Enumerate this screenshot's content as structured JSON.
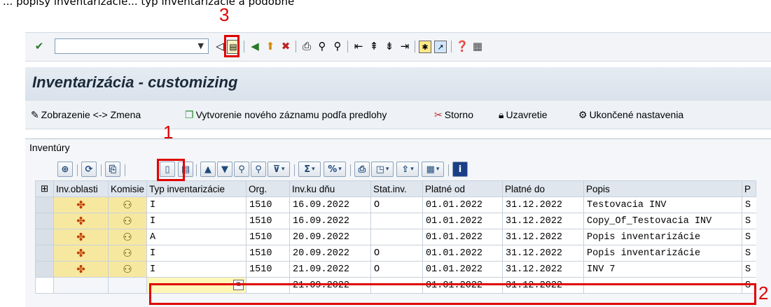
{
  "caption": "... popisy inventarizácie... typ inventarizácie a podobne",
  "annotations": {
    "step1": "1",
    "step2": "2",
    "step3": "3"
  },
  "system_toolbar": {
    "icons": [
      "enter-check-icon",
      "command-field",
      "back-arrow-icon",
      "save-icon",
      "back-green-icon",
      "exit-yellow-icon",
      "cancel-red-icon",
      "print-icon",
      "find-icon",
      "find-next-icon",
      "first-page-icon",
      "prev-page-icon",
      "next-page-icon",
      "last-page-icon",
      "new-session-icon",
      "shortcut-icon",
      "help-icon",
      "layout-menu-icon"
    ]
  },
  "title": "Inventarizácia - customizing",
  "app_toolbar": {
    "display_change": "Zobrazenie <-> Zmena",
    "create_from_template": "Vytvorenie nového záznamu podľa predlohy",
    "storno": "Storno",
    "close": "Uzavretie",
    "finished_settings": "Ukončené nastavenia"
  },
  "group_label": "Inventúry",
  "table": {
    "columns": [
      "Inv.oblasti",
      "Komisie",
      "Typ inventarizácie",
      "Org.",
      "Inv.ku dňu",
      "Stat.inv.",
      "Platné od",
      "Platné do",
      "Popis",
      "P"
    ],
    "rows": [
      {
        "typ": "I",
        "org": "1510",
        "date": "16.09.2022",
        "stat": "O",
        "od": "01.01.2022",
        "do": "31.12.2022",
        "popis": "Testovacia INV",
        "p": "S"
      },
      {
        "typ": "I",
        "org": "1510",
        "date": "16.09.2022",
        "stat": "",
        "od": "01.01.2022",
        "do": "31.12.2022",
        "popis": "Copy_Of_Testovacia INV",
        "p": "S"
      },
      {
        "typ": "A",
        "org": "1510",
        "date": "20.09.2022",
        "stat": "",
        "od": "01.01.2022",
        "do": "31.12.2022",
        "popis": "Popis inventarizácie",
        "p": "S"
      },
      {
        "typ": "I",
        "org": "1510",
        "date": "20.09.2022",
        "stat": "O",
        "od": "01.01.2022",
        "do": "31.12.2022",
        "popis": "Popis inventarizácie",
        "p": "S"
      },
      {
        "typ": "I",
        "org": "1510",
        "date": "21.09.2022",
        "stat": "O",
        "od": "01.01.2022",
        "do": "31.12.2022",
        "popis": "INV 7",
        "p": "S"
      }
    ],
    "new_row": {
      "typ": "",
      "org": "",
      "date": "21.09.2022",
      "stat": "",
      "od": "01.01.2022",
      "do": "31.12.2022",
      "popis": "",
      "p": "S"
    }
  }
}
